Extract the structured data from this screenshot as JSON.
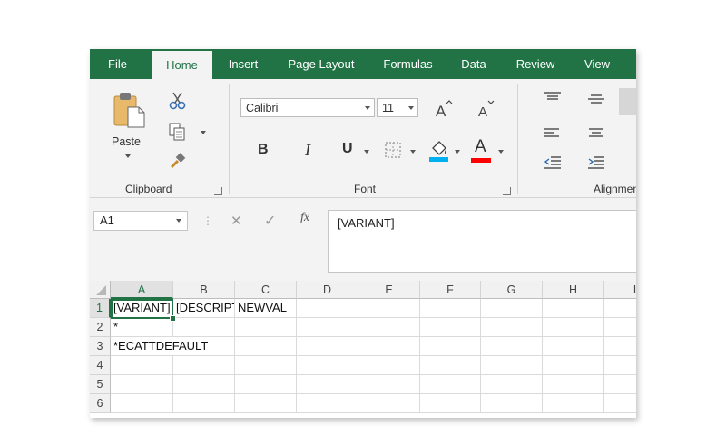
{
  "tabs": [
    "File",
    "Home",
    "Insert",
    "Page Layout",
    "Formulas",
    "Data",
    "Review",
    "View"
  ],
  "active_tab": "Home",
  "clipboard": {
    "paste_label": "Paste",
    "group_label": "Clipboard"
  },
  "font": {
    "name": "Calibri",
    "size": "11",
    "group_label": "Font",
    "bold": "B",
    "italic": "I",
    "underline": "U",
    "font_color_glyph": "A",
    "fill_color": "#00b0f0",
    "font_color": "#ff0000"
  },
  "alignment": {
    "group_label": "Alignment"
  },
  "formula_bar": {
    "name_box": "A1",
    "fx": "fx",
    "cancel": "✕",
    "enter": "✓",
    "content": "[VARIANT]"
  },
  "columns": [
    "A",
    "B",
    "C",
    "D",
    "E",
    "F",
    "G",
    "H",
    "I"
  ],
  "rows": [
    "1",
    "2",
    "3",
    "4",
    "5",
    "6"
  ],
  "cells": {
    "A1": "[VARIANT]",
    "B1": "[DESCRIPTION]",
    "C1": "NEWVAL",
    "A2": "*",
    "A3": "*ECATTDEFAULT"
  },
  "accent": "#217346"
}
